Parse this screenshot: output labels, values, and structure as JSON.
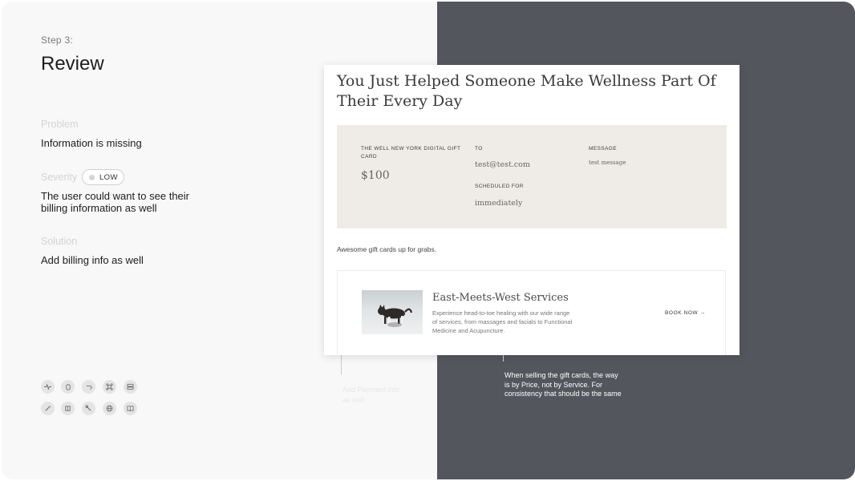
{
  "left": {
    "step_label": "Step 3:",
    "title": "Review",
    "problem_label": "Problem",
    "problem_text": "Information is missing",
    "severity_label": "Severity",
    "severity_badge": "LOW",
    "severity_text_1": "The user could want to see their",
    "severity_text_2": "billing information as well",
    "solution_label": "Solution",
    "solution_text": "Add billing info as well",
    "icons_row1": [
      "activity-icon",
      "hand-icon",
      "undo-icon",
      "command-icon",
      "server-icon"
    ],
    "icons_row2": [
      "wand-icon",
      "book-open-icon",
      "tool-icon",
      "globe-icon",
      "book-icon"
    ]
  },
  "mockup": {
    "headline": "You Just Helped Someone Make Wellness Part Of Their Every Day",
    "gift_card": {
      "card_label": "THE WELL NEW YORK DIGITAL GIFT CARD",
      "amount": "$100",
      "to_label": "TO",
      "to_value": "test@test.com",
      "scheduled_label": "SCHEDULED FOR",
      "scheduled_value": "immediately",
      "message_label": "MESSAGE",
      "message_value": "test message"
    },
    "awesome_text": "Awesome gift cards up for grabs.",
    "service": {
      "title": "East-Meets-West Services",
      "description": "Experience head-to-toe healing with our wide range of services, from massages and facials to Functional Medicine and Acupuncture.",
      "cta": "BOOK NOW →"
    }
  },
  "annotations": {
    "faint_note": "Add Payment info as well",
    "note": "When selling the gift cards, the way is by Price, not by Service. For consistency that should be the same"
  }
}
